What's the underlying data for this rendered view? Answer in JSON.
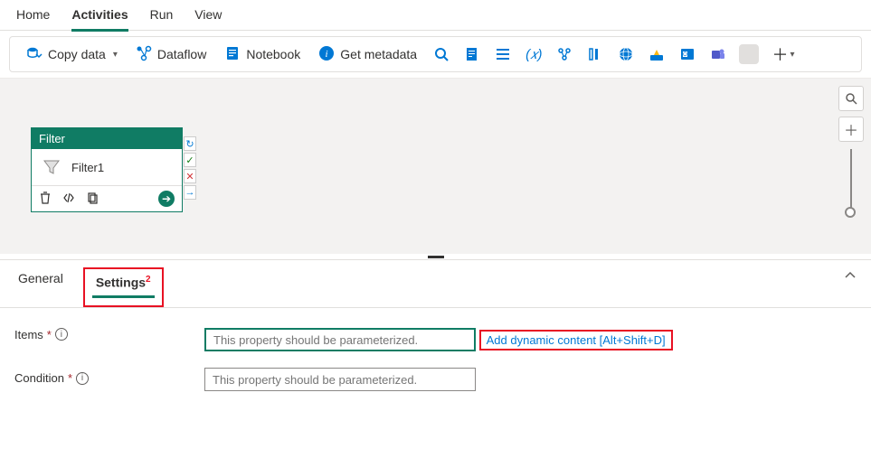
{
  "topTabs": {
    "home": "Home",
    "activities": "Activities",
    "run": "Run",
    "view": "View"
  },
  "toolbar": {
    "copyData": "Copy data",
    "dataflow": "Dataflow",
    "notebook": "Notebook",
    "getMetadata": "Get metadata"
  },
  "node": {
    "type": "Filter",
    "name": "Filter1"
  },
  "panelTabs": {
    "general": "General",
    "settings": "Settings",
    "badge": "2"
  },
  "form": {
    "itemsLabel": "Items",
    "itemsPlaceholder": "This property should be parameterized.",
    "dynamicLink": "Add dynamic content [Alt+Shift+D]",
    "conditionLabel": "Condition",
    "conditionPlaceholder": "This property should be parameterized."
  },
  "colors": {
    "brand": "#107c64",
    "link": "#0078d4",
    "danger": "#e81123"
  }
}
